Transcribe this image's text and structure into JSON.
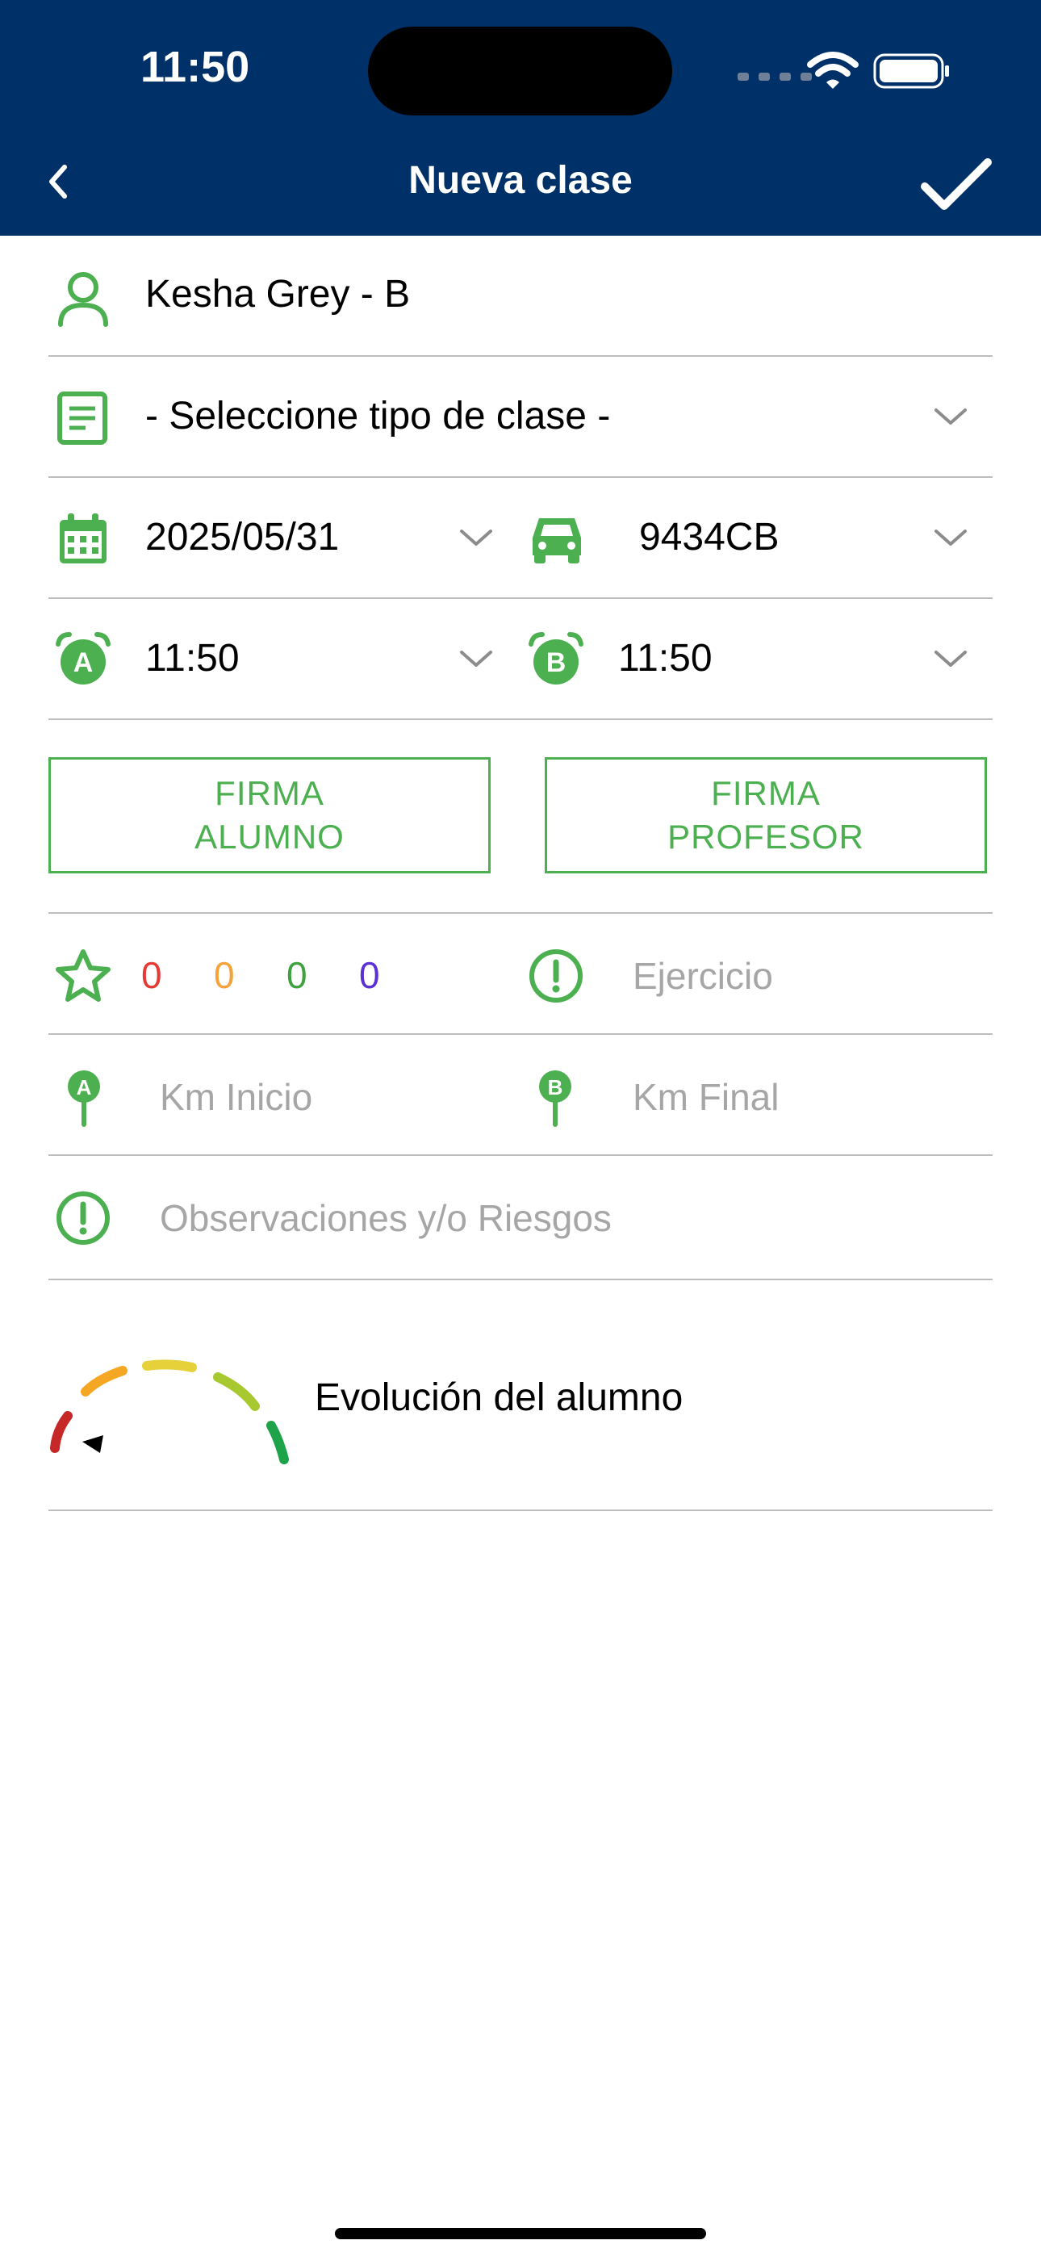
{
  "status_bar": {
    "time": "11:50",
    "icons": [
      "signal-icon",
      "wifi-icon",
      "battery-icon"
    ]
  },
  "nav": {
    "title": "Nueva clase",
    "back_icon": "chevron-left-icon",
    "confirm_icon": "checkmark-icon"
  },
  "form": {
    "student": {
      "icon": "person-icon",
      "value": "Kesha Grey - B"
    },
    "class_type": {
      "icon": "document-icon",
      "value": "- Seleccione tipo de clase -"
    },
    "date": {
      "icon": "calendar-icon",
      "value": "2025/05/31"
    },
    "vehicle": {
      "icon": "car-icon",
      "value": "9434CB"
    },
    "time_start": {
      "icon": "alarm-a-icon",
      "value": "11:50"
    },
    "time_end": {
      "icon": "alarm-b-icon",
      "value": "11:50"
    },
    "signatures": {
      "student_line1": "FIRMA",
      "student_line2": "ALUMNO",
      "teacher_line1": "FIRMA",
      "teacher_line2": "PROFESOR"
    },
    "ratings": {
      "icon": "star-icon",
      "counts": [
        {
          "value": "0",
          "color": "#e53935"
        },
        {
          "value": "0",
          "color": "#f5a23a"
        },
        {
          "value": "0",
          "color": "#3fa13f"
        },
        {
          "value": "0",
          "color": "#5a2fd3"
        }
      ]
    },
    "exercise": {
      "icon": "exclamation-circle-icon",
      "placeholder": "Ejercicio"
    },
    "km_start": {
      "icon": "pin-a-icon",
      "placeholder": "Km Inicio"
    },
    "km_end": {
      "icon": "pin-b-icon",
      "placeholder": "Km Final"
    },
    "observations": {
      "icon": "exclamation-circle-icon",
      "placeholder": "Observaciones y/o Riesgos"
    },
    "evolution": {
      "icon": "gauge-icon",
      "label": "Evolución del alumno"
    }
  },
  "colors": {
    "header_bg": "#003068",
    "accent_green": "#4caf50",
    "divider": "#bdbdbd",
    "placeholder": "#a6a6a6"
  }
}
